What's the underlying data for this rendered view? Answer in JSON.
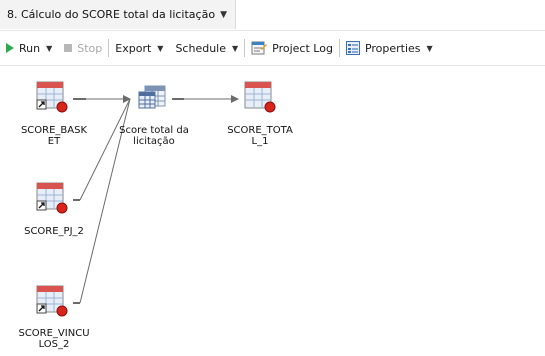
{
  "title_tab": {
    "label": "8. Cálculo do SCORE total da licitação"
  },
  "toolbar": {
    "run_label": "Run",
    "stop_label": "Stop",
    "export_label": "Export",
    "schedule_label": "Schedule",
    "project_log_label": "Project Log",
    "properties_label": "Properties"
  },
  "nodes": {
    "score_basket": {
      "label_1": "SCORE_BASK",
      "label_2": "ET"
    },
    "score_pj_2": {
      "label_1": "SCORE_PJ_2"
    },
    "score_vinculos_2": {
      "label_1": "SCORE_VINCU",
      "label_2": "LOS_2"
    },
    "query": {
      "label_1": "Score total da",
      "label_2": "licitação"
    },
    "score_total_1": {
      "label_1": "SCORE_TOTA",
      "label_2": "L_1"
    }
  },
  "colors": {
    "table_header": "#d9534f",
    "table_body": "#e8eef7",
    "status_dot": "#d9241c",
    "play": "#2fa84f",
    "edge": "#6b6b6b"
  }
}
